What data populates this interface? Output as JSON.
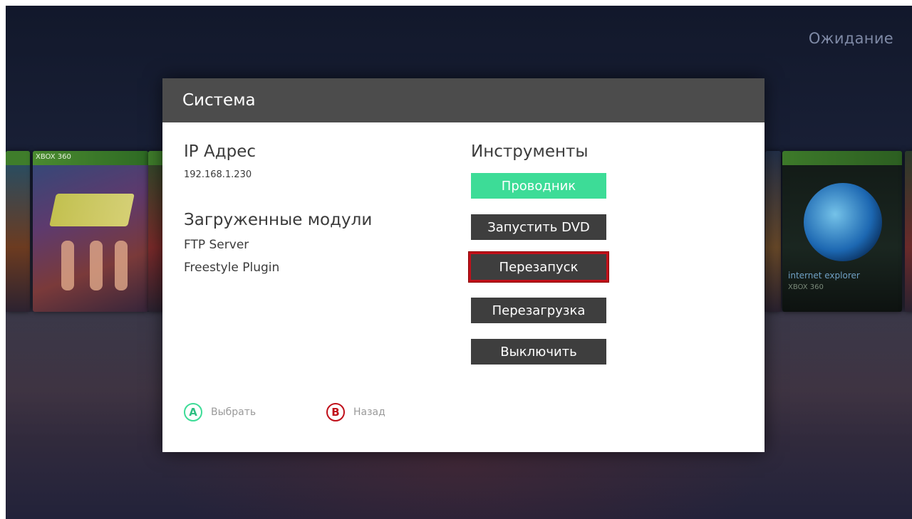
{
  "status": "Ожидание",
  "background": {
    "covers": [
      {
        "name": "kinect-sports",
        "badge": "XBOX 360"
      },
      {
        "name": "internet-explorer",
        "title": "internet explorer",
        "platform": "XBOX 360"
      }
    ]
  },
  "dialog": {
    "title": "Система",
    "ip_label": "IP Адрес",
    "ip_value": "192.168.1.230",
    "modules_label": "Загруженные модули",
    "modules": [
      "FTP Server",
      "Freestyle Plugin"
    ],
    "tools_label": "Инструменты",
    "tools": [
      "Проводник",
      "Запустить DVD",
      "Перезапуск",
      "Перезагрузка",
      "Выключить"
    ],
    "selected_tool": "Проводник",
    "focused_tool": "Перезапуск"
  },
  "hints": {
    "a_key": "A",
    "a_label": "Выбрать",
    "b_key": "B",
    "b_label": "Назад"
  },
  "colors": {
    "selected": "#3ddc97",
    "focus_border": "#c0101a",
    "button": "#3e3e3e",
    "header": "#4c4c4c"
  }
}
